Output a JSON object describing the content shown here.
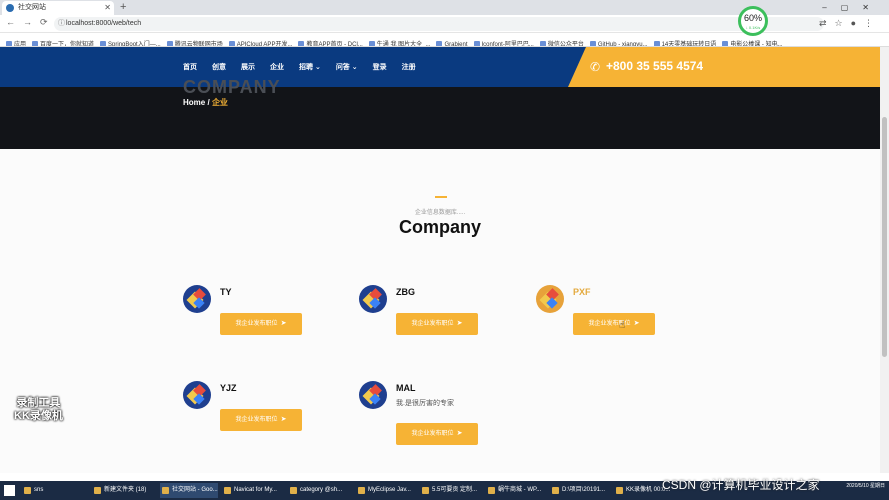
{
  "browser": {
    "tab_title": "社交网站",
    "url": "localhost:8000/web/tech",
    "new_tab": "+",
    "bookmarks": [
      "应用",
      "百度一下，你就知道",
      "SpringBoot入门—...",
      "腾讯云物联网市场",
      "APICloud APP开发...",
      "教育APP首页 - DCl...",
      "牛通 我 图片大全_...",
      "Grabient",
      "Iconfont-阿里巴巴...",
      "微信公众平台",
      "GitHub - xiangyu...",
      "14天零基础玩转日语",
      "电影公棒课 - 知电..."
    ],
    "speed_percent": "60%",
    "speed_rate": "↓ 0.1K/s"
  },
  "site": {
    "menu": [
      "首页",
      "创意",
      "展示",
      "企业",
      "招聘 ⌄",
      "问答 ⌄",
      "登录",
      "注册"
    ],
    "phone": "+800 35 555 4574",
    "hero_ghost": "COMPANY",
    "breadcrumb": {
      "home": "Home",
      "sep": "/",
      "current": "企业"
    },
    "section_subtitle": "企业信息数据库.....",
    "section_title": "Company",
    "companies": [
      {
        "name": "TY",
        "desc": "",
        "button": "我企业发布职位"
      },
      {
        "name": "ZBG",
        "desc": "",
        "button": "我企业发布职位"
      },
      {
        "name": "PXF",
        "desc": "",
        "button": "我企业发布职位"
      },
      {
        "name": "YJZ",
        "desc": "",
        "button": "我企业发布职位"
      },
      {
        "name": "MAL",
        "desc": "我.是很厉害的专家",
        "button": "我企业发布职位"
      }
    ]
  },
  "overlay": {
    "watermark_line1": "录制工具",
    "watermark_line2": "KK录像机",
    "csdn": "CSDN @计算机毕业设计之家"
  },
  "taskbar": {
    "items": [
      "sns",
      "新建文件夹 (18)",
      "社交网站 - Goo...",
      "Navicat for My...",
      "category @sh...",
      "MyEclipse Jav...",
      "5.5可要贡 定制...",
      "蜗牛商城 - WP...",
      "D:\\项目\\20191...",
      "KK录像机 00:0..."
    ],
    "time": "",
    "date": "2020/5/10 星期日"
  },
  "colors": {
    "nav": "#0a3a80",
    "accent": "#f6b335"
  }
}
